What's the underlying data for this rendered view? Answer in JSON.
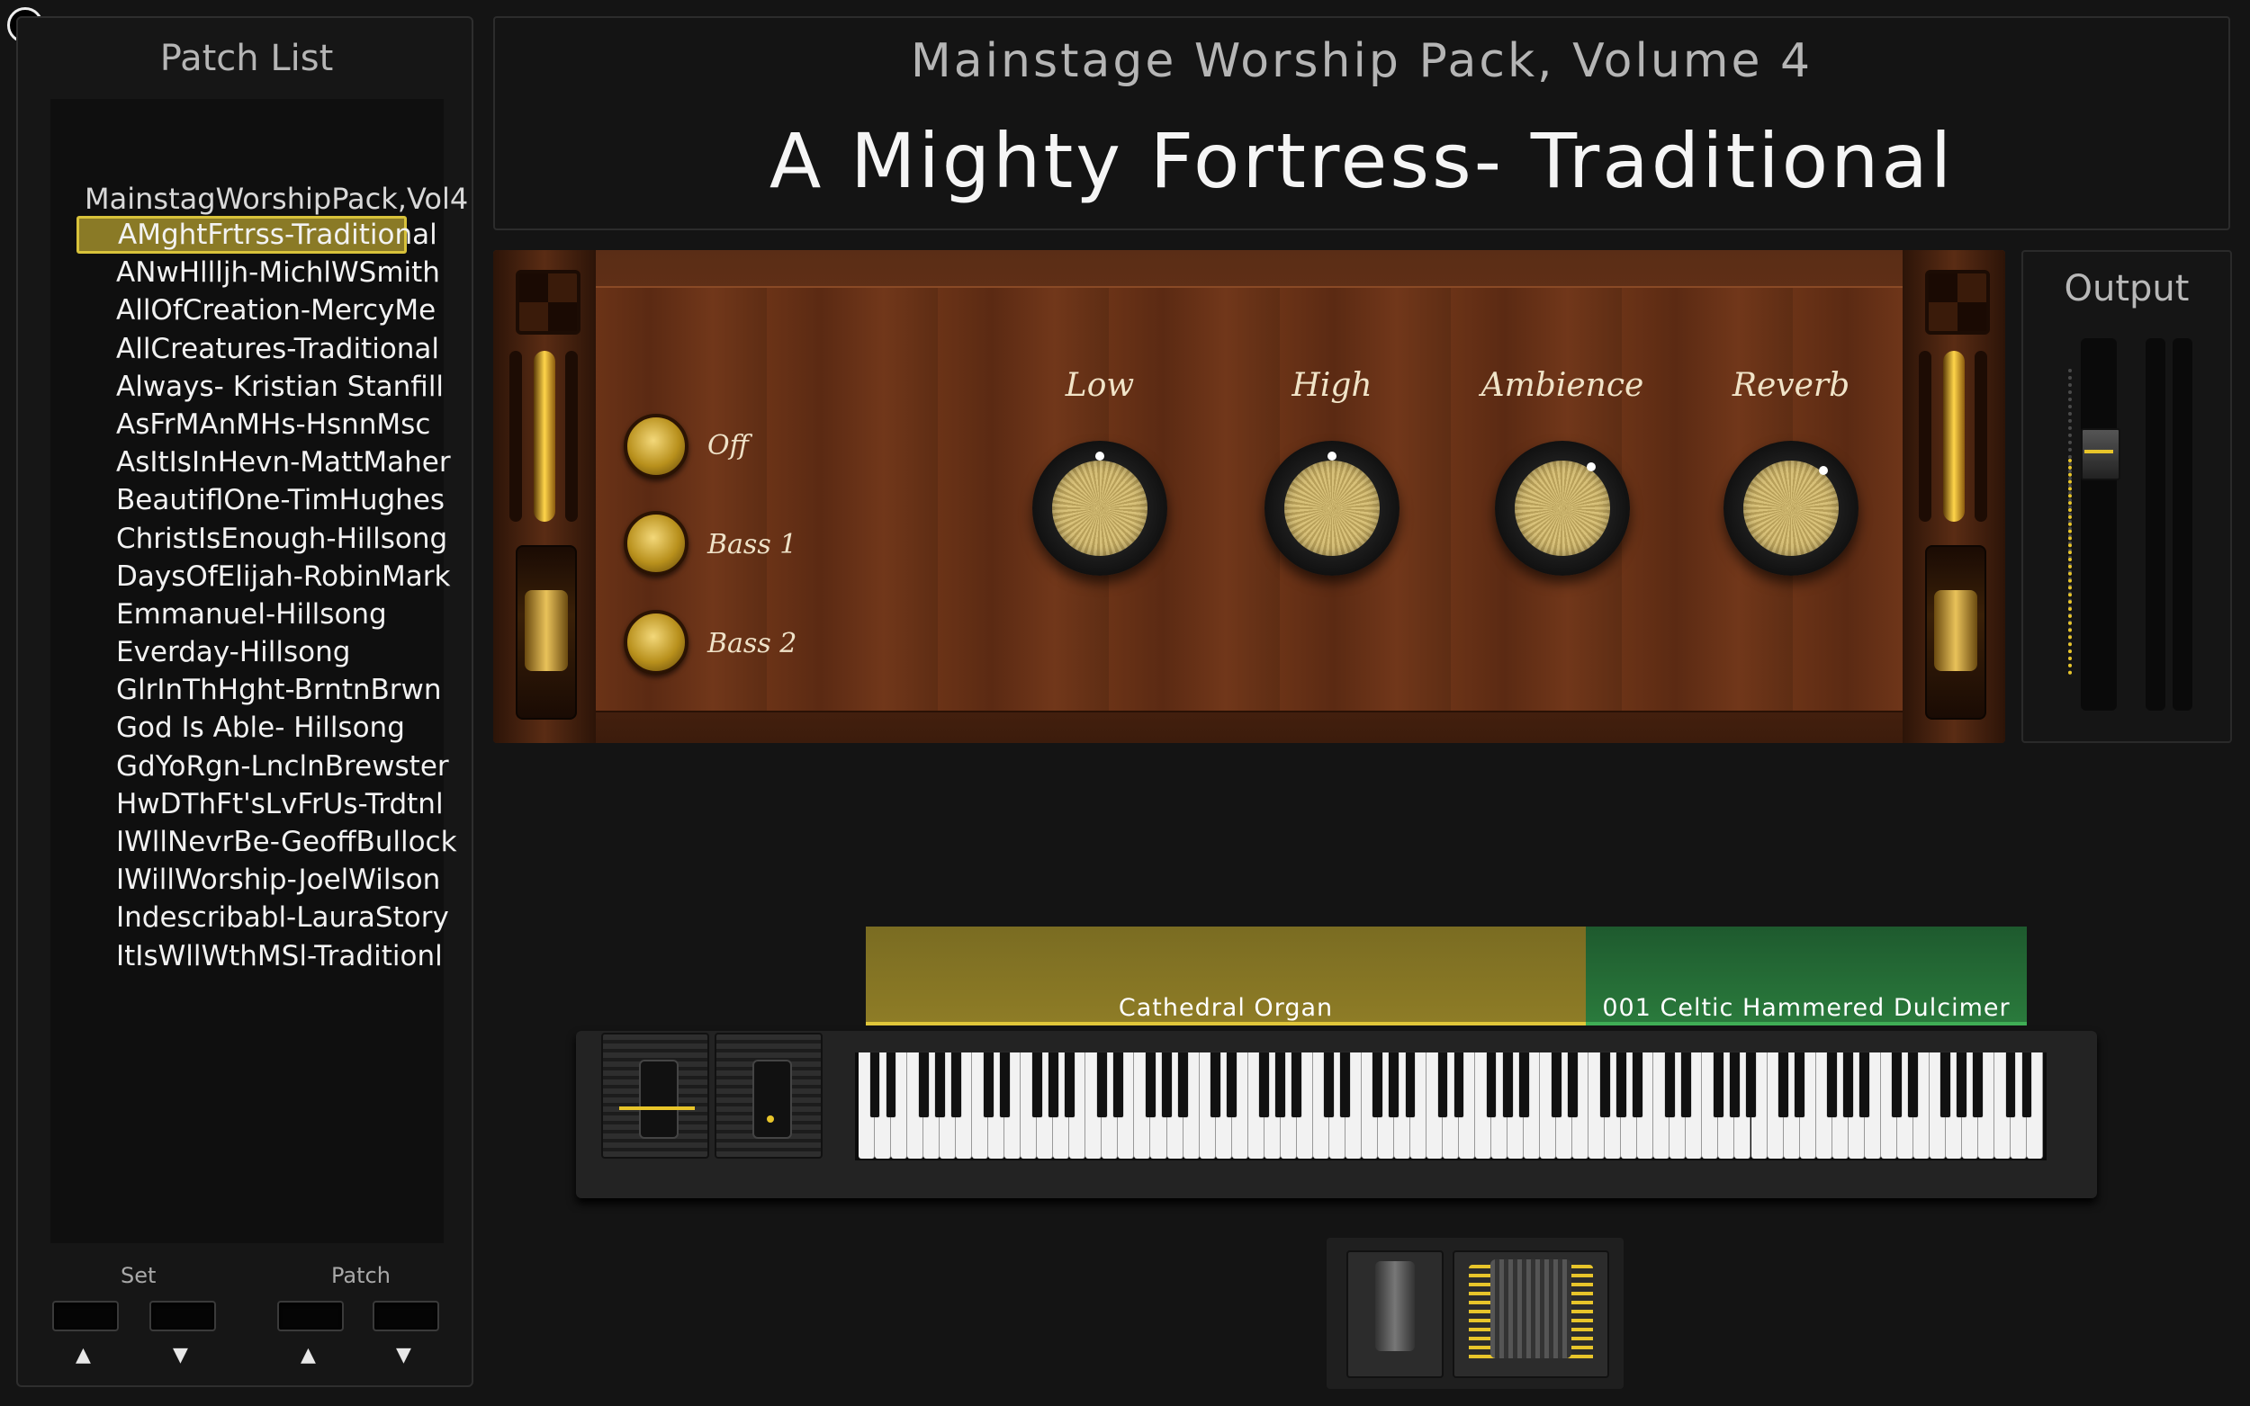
{
  "patch_list": {
    "title": "Patch List",
    "set_name": "MainstagWorshipPack,Vol4",
    "items": [
      {
        "label": "AMghtFrtrss-Traditional",
        "selected": true
      },
      {
        "label": "ANwHllljh-MichlWSmith"
      },
      {
        "label": "AllOfCreation-MercyMe"
      },
      {
        "label": "AllCreatures-Traditional"
      },
      {
        "label": "Always- Kristian Stanfill"
      },
      {
        "label": "AsFrMAnMHs-HsnnMsc"
      },
      {
        "label": "AsItIsInHevn-MattMaher"
      },
      {
        "label": "BeautiflOne-TimHughes"
      },
      {
        "label": "ChristIsEnough-Hillsong"
      },
      {
        "label": "DaysOfElijah-RobinMark"
      },
      {
        "label": "Emmanuel-Hillsong"
      },
      {
        "label": "Everday-Hillsong"
      },
      {
        "label": "GlrInThHght-BrntnBrwn"
      },
      {
        "label": "God Is Able- Hillsong"
      },
      {
        "label": "GdYoRgn-LnclnBrewster"
      },
      {
        "label": "HwDThFt'sLvFrUs-Trdtnl"
      },
      {
        "label": "IWllNevrBe-GeoffBullock"
      },
      {
        "label": "IWillWorship-JoelWilson"
      },
      {
        "label": "Indescribabl-LauraStory"
      },
      {
        "label": "ItIsWllWthMSl-Traditionl"
      }
    ],
    "set_label": "Set",
    "patch_label": "Patch",
    "up_glyph": "▲",
    "down_glyph": "▼"
  },
  "header": {
    "concert_title": "Mainstage Worship Pack, Volume 4",
    "patch_name": "A Mighty Fortress- Traditional"
  },
  "organ": {
    "bass_buttons": [
      "Off",
      "Bass 1",
      "Bass 2"
    ],
    "knobs": [
      {
        "label": "Low"
      },
      {
        "label": "High"
      },
      {
        "label": "Ambience"
      },
      {
        "label": "Reverb"
      }
    ]
  },
  "output": {
    "title": "Output"
  },
  "instruments": {
    "left": "Cathedral Organ",
    "right": "001 Celtic Hammered Dulcimer"
  },
  "colors": {
    "selected_bg": "#8a7a26",
    "selected_border": "#d8c23a",
    "strip_gold": "#8e7c26",
    "strip_green": "#2a7a3c"
  }
}
